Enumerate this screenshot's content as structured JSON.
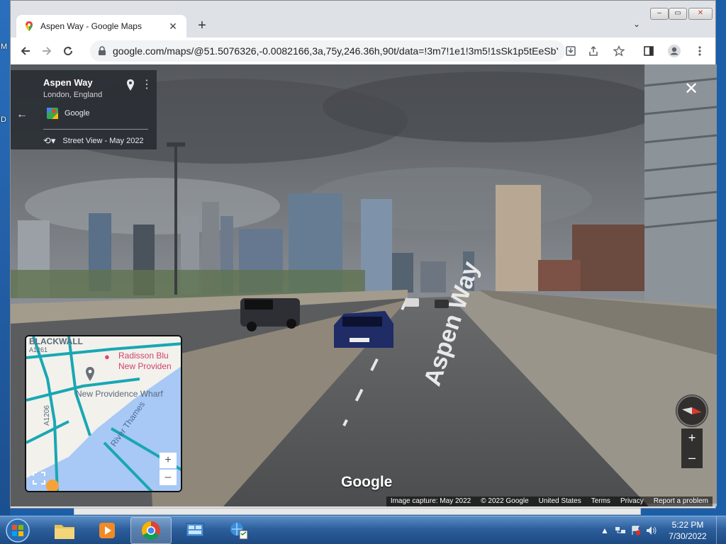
{
  "desktop": {
    "edge_letters": [
      "M",
      "D"
    ]
  },
  "browser": {
    "tab_title": "Aspen Way - Google Maps",
    "tab_close": "✕",
    "new_tab": "+",
    "tab_list": "⌄",
    "url": "google.com/maps/@51.5076326,-0.0082166,3a,75y,246.36h,90t/data=!3m7!1e1!3m5!1sSk1p5tEeSbYl...",
    "window_controls": {
      "minimize": "–",
      "maximize": "▭",
      "close": "✕"
    }
  },
  "streetview": {
    "place_title": "Aspen Way",
    "place_sub": "London, England",
    "provider": "Google",
    "date_label": "Street View - May 2022",
    "road_text": "Aspen Way",
    "watermark": "Google",
    "minimap": {
      "labels": {
        "blackwall": "BLACKWALL",
        "hotel_line1": "Radisson Blu",
        "hotel_line2": "New Providen",
        "wharf": "New Providence Wharf",
        "road": "A1206",
        "river": "River Thames",
        "a1261": "A1261"
      },
      "zoom_in": "+",
      "zoom_out": "–"
    },
    "zoom_in": "+",
    "zoom_out": "–",
    "attribution": {
      "capture": "Image capture: May 2022",
      "copyright": "© 2022 Google",
      "country": "United States",
      "terms": "Terms",
      "privacy": "Privacy",
      "report": "Report a problem"
    }
  },
  "taskbar": {
    "time": "5:22 PM",
    "date": "7/30/2022"
  }
}
